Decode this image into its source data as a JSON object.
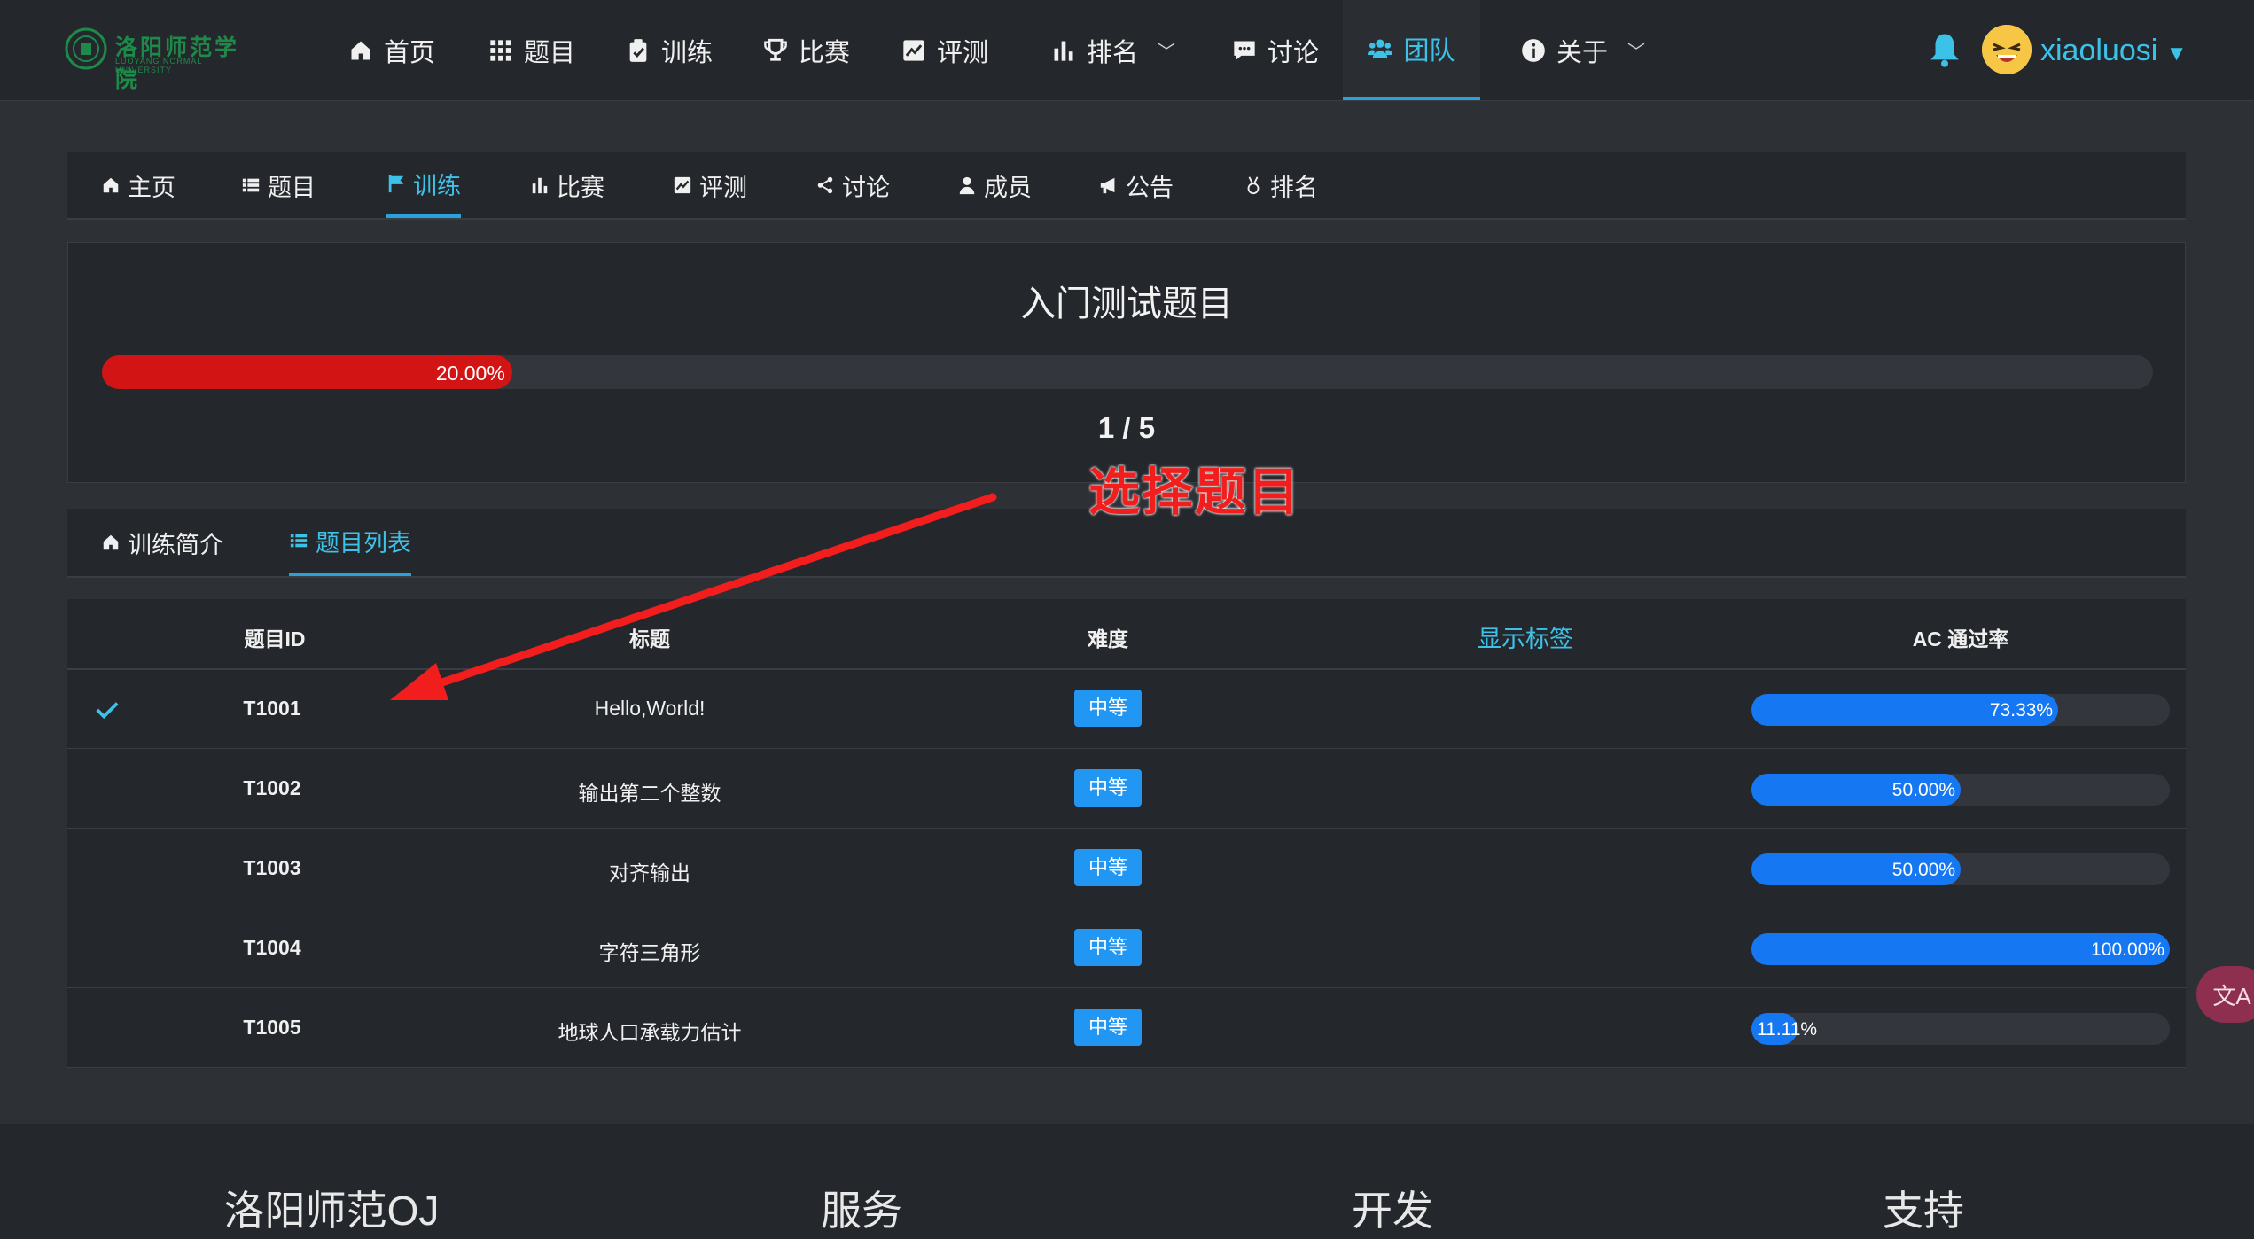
{
  "brand": {
    "logo_title": "洛阳师范学院",
    "logo_sub": "LUOYANG NORMAL UNIVERSITY",
    "logo_color": "#1e8a4a"
  },
  "topnav": {
    "items": [
      {
        "label": "首页",
        "icon": "home-icon"
      },
      {
        "label": "题目",
        "icon": "grid-icon"
      },
      {
        "label": "训练",
        "icon": "clipboard-check-icon"
      },
      {
        "label": "比赛",
        "icon": "trophy-icon"
      },
      {
        "label": "评测",
        "icon": "chart-line-icon"
      },
      {
        "label": "排名",
        "icon": "bar-chart-icon"
      },
      {
        "label": "讨论",
        "icon": "comment-icon"
      },
      {
        "label": "团队",
        "icon": "users-icon"
      },
      {
        "label": "关于",
        "icon": "info-icon"
      }
    ],
    "active": "团队",
    "username": "xiaoluosi"
  },
  "subnav": {
    "items": [
      {
        "label": "主页",
        "icon": "home-icon"
      },
      {
        "label": "题目",
        "icon": "list-icon"
      },
      {
        "label": "训练",
        "icon": "flag-icon"
      },
      {
        "label": "比赛",
        "icon": "bar-chart-icon"
      },
      {
        "label": "评测",
        "icon": "chart-line-icon"
      },
      {
        "label": "讨论",
        "icon": "share-icon"
      },
      {
        "label": "成员",
        "icon": "user-icon"
      },
      {
        "label": "公告",
        "icon": "bullhorn-icon"
      },
      {
        "label": "排名",
        "icon": "medal-icon"
      }
    ],
    "active": "训练"
  },
  "training": {
    "title": "入门测试题目",
    "progress": 0.2,
    "progress_label": "20.00%",
    "count": "1 / 5"
  },
  "annotation": {
    "text": "选择题目",
    "color": "#f21d1d"
  },
  "tabs": {
    "items": [
      {
        "label": "训练简介",
        "icon": "home-icon"
      },
      {
        "label": "题目列表",
        "icon": "list-icon"
      }
    ],
    "active": "题目列表"
  },
  "problem_table": {
    "headers": {
      "id": "题目ID",
      "title": "标题",
      "difficulty": "难度",
      "tags": "显示标签",
      "ac_rate": "AC 通过率"
    },
    "rows": [
      {
        "solved": true,
        "id": "T1001",
        "title": "Hello,World!",
        "difficulty": "中等",
        "ac": 0.7333,
        "ac_label": "73.33%"
      },
      {
        "solved": false,
        "id": "T1002",
        "title": "输出第二个整数",
        "difficulty": "中等",
        "ac": 0.5,
        "ac_label": "50.00%"
      },
      {
        "solved": false,
        "id": "T1003",
        "title": "对齐输出",
        "difficulty": "中等",
        "ac": 0.5,
        "ac_label": "50.00%"
      },
      {
        "solved": false,
        "id": "T1004",
        "title": "字符三角形",
        "difficulty": "中等",
        "ac": 1.0,
        "ac_label": "100.00%"
      },
      {
        "solved": false,
        "id": "T1005",
        "title": "地球人口承载力估计",
        "difficulty": "中等",
        "ac": 0.1111,
        "ac_label": "11.11%"
      }
    ]
  },
  "footer": {
    "columns": [
      "洛阳师范OJ",
      "服务",
      "开发",
      "支持"
    ]
  },
  "colors": {
    "accent": "#3cc2e8",
    "progress_red": "#d21414",
    "ac_blue": "#1677f2",
    "badge_blue": "#2196f3",
    "bg": "#2d3035",
    "panel": "#24272b"
  }
}
